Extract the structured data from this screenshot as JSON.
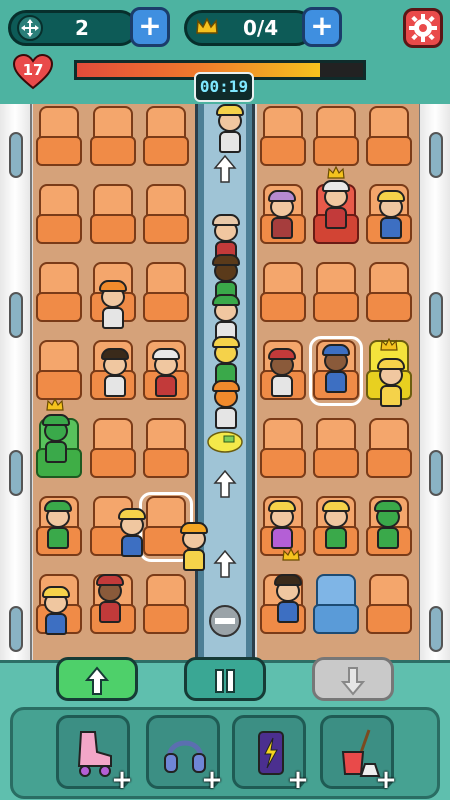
{
  "hud": {
    "moves": "2",
    "crowns": "0/4",
    "lives": "17",
    "timer": "00:19",
    "progress": 0.85
  },
  "icons": {
    "moves": "move-arrows-icon",
    "crowns": "crown-icon",
    "settings": "gear-icon",
    "lives": "heart-icon"
  },
  "controls": {
    "up": "arrow-up-icon",
    "pause": "pause-icon",
    "down": "arrow-down-icon"
  },
  "powerups": [
    {
      "name": "roller-skate",
      "add": "+"
    },
    {
      "name": "headphones",
      "add": "+"
    },
    {
      "name": "energy-can",
      "add": "+"
    },
    {
      "name": "mop-bucket",
      "add": "+"
    }
  ],
  "colors": {
    "bg": "#5fbfae",
    "aisle": "#9fc4d6",
    "seat": "#f08b47",
    "accent_green": "#4ed06a",
    "accent_blue": "#3f8fe0",
    "accent_red": "#e94a4a"
  }
}
